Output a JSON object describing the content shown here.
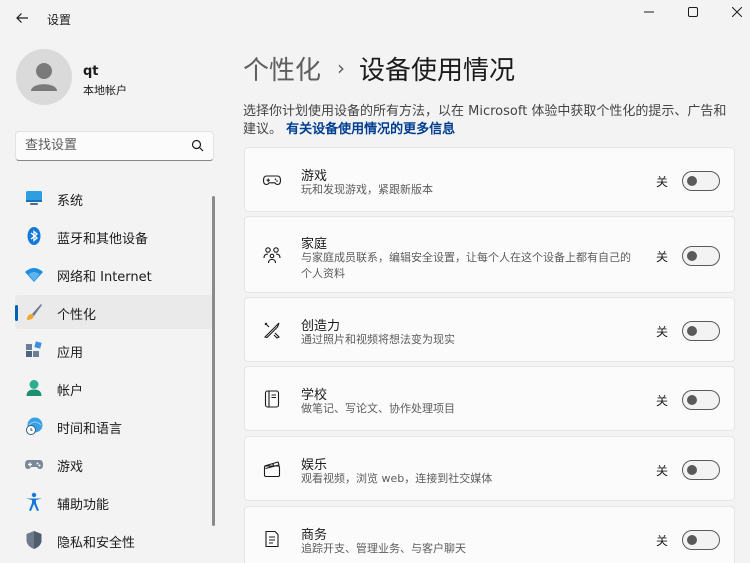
{
  "window": {
    "title": "设置"
  },
  "user": {
    "name": "qt",
    "account_type": "本地帐户"
  },
  "search": {
    "placeholder": "查找设置"
  },
  "nav": {
    "items": [
      {
        "label": "系统",
        "icon": "system-icon"
      },
      {
        "label": "蓝牙和其他设备",
        "icon": "bluetooth-icon"
      },
      {
        "label": "网络和 Internet",
        "icon": "wifi-icon"
      },
      {
        "label": "个性化",
        "icon": "brush-icon",
        "active": true
      },
      {
        "label": "应用",
        "icon": "apps-icon"
      },
      {
        "label": "帐户",
        "icon": "account-icon"
      },
      {
        "label": "时间和语言",
        "icon": "time-language-icon"
      },
      {
        "label": "游戏",
        "icon": "gamepad-icon"
      },
      {
        "label": "辅助功能",
        "icon": "accessibility-icon"
      },
      {
        "label": "隐私和安全性",
        "icon": "shield-icon"
      }
    ]
  },
  "breadcrumb": {
    "parent": "个性化",
    "separator": "›",
    "current": "设备使用情况"
  },
  "description": {
    "text": "选择你计划使用设备的所有方法，以在 Microsoft 体验中获取个性化的提示、广告和建议。",
    "link": "有关设备使用情况的更多信息"
  },
  "cards": [
    {
      "title": "游戏",
      "subtitle": "玩和发现游戏，紧跟新版本",
      "state": "关",
      "icon": "gamepad-icon",
      "on": false
    },
    {
      "title": "家庭",
      "subtitle": "与家庭成员联系，编辑安全设置，让每个人在这个设备上都有自己的个人资料",
      "state": "关",
      "icon": "family-icon",
      "on": false
    },
    {
      "title": "创造力",
      "subtitle": "通过照片和视频将想法变为现实",
      "state": "关",
      "icon": "creativity-icon",
      "on": false
    },
    {
      "title": "学校",
      "subtitle": "做笔记、写论文、协作处理项目",
      "state": "关",
      "icon": "school-icon",
      "on": false
    },
    {
      "title": "娱乐",
      "subtitle": "观看视频，浏览 web，连接到社交媒体",
      "state": "关",
      "icon": "entertainment-icon",
      "on": false
    },
    {
      "title": "商务",
      "subtitle": "追踪开支、管理业务、与客户聊天",
      "state": "关",
      "icon": "business-icon",
      "on": false
    }
  ],
  "colors": {
    "accent": "#0063b1",
    "link": "#003e92",
    "background": "#f3f3f3",
    "card": "#fbfbfb"
  }
}
